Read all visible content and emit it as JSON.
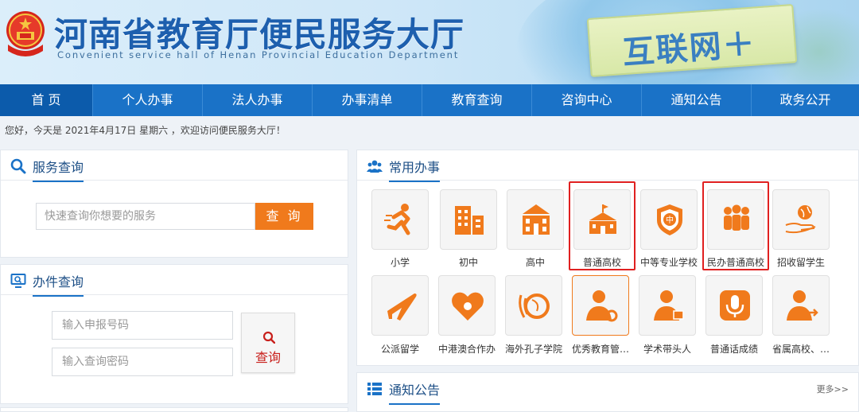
{
  "header": {
    "title": "河南省教育厅便民服务大厅",
    "subtitle": "Convenient service hall of Henan Provincial Education Department",
    "sign_text": "互联网＋"
  },
  "nav": {
    "items": [
      {
        "label": "首 页",
        "active": true
      },
      {
        "label": "个人办事"
      },
      {
        "label": "法人办事"
      },
      {
        "label": "办事清单"
      },
      {
        "label": "教育查询"
      },
      {
        "label": "咨询中心"
      },
      {
        "label": "通知公告"
      },
      {
        "label": "政务公开"
      }
    ]
  },
  "greeting": "您好，今天是 2021年4月17日 星期六 ，欢迎访问便民服务大厅！",
  "service_query": {
    "title": "服务查询",
    "placeholder": "快速查询你想要的服务",
    "button": "查 询"
  },
  "case_query": {
    "title": "办件查询",
    "apply_placeholder": "输入申报号码",
    "password_placeholder": "输入查询密码",
    "button": "查询"
  },
  "common": {
    "title": "常用办事",
    "row1": [
      "小学",
      "初中",
      "高中",
      "普通高校",
      "中等专业学校",
      "民办普通高校",
      "招收留学生"
    ],
    "row2": [
      "公派留学",
      "中港澳合作办",
      "海外孔子学院",
      "优秀教育管…",
      "学术带头人",
      "普通话成绩",
      "省属高校、…"
    ]
  },
  "notice": {
    "title": "通知公告",
    "more": "更多>>"
  },
  "colors": {
    "nav": "#1a72c7",
    "accent": "#f07a1c",
    "highlight": "#e02020"
  }
}
